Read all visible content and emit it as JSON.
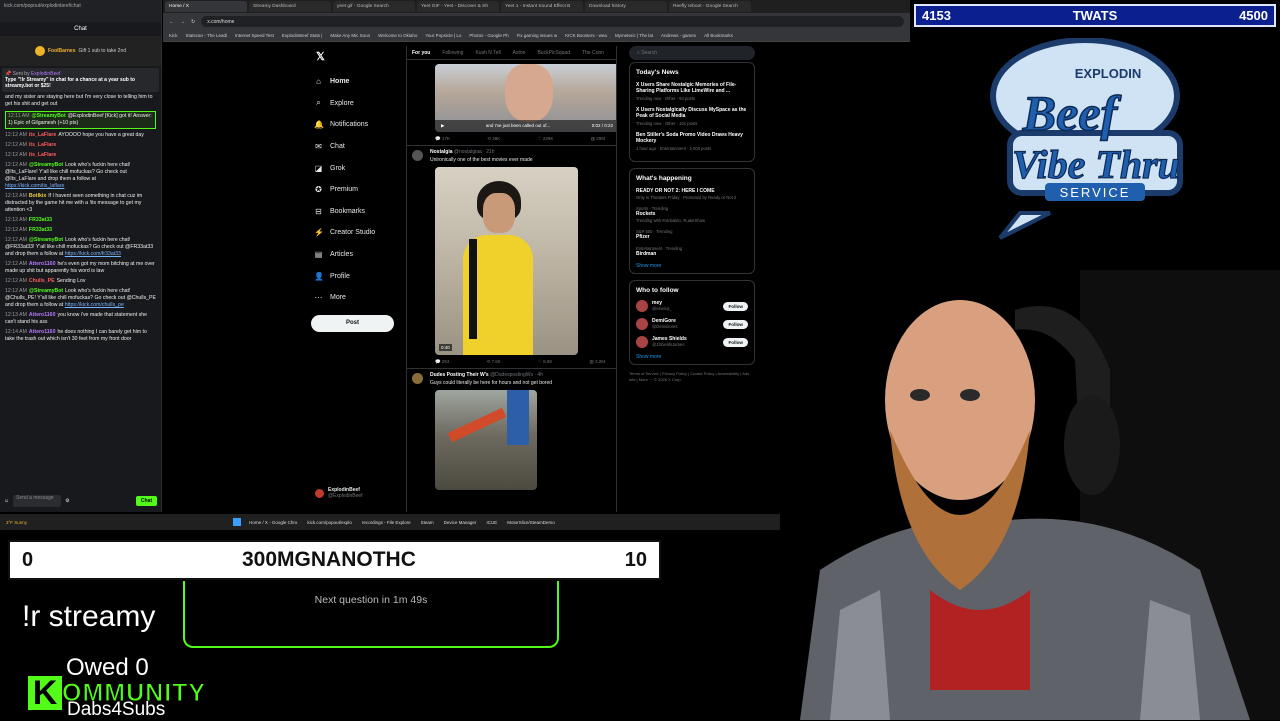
{
  "chat": {
    "url": "kick.com/popout/explodinbeef/chat",
    "title": "Chat",
    "gift_user": "FoolBarnes",
    "gift_text": "Gift 1 sub to take 2nd",
    "pinned_by": "ExplodinBeef",
    "pinned_text": "Type \"!lr Streamy\" in chat for a chance at a year sub to streamy.bot or $25!",
    "messages": [
      {
        "time": "",
        "user": "",
        "color": "",
        "text": "and my sister are staying here but I'm very close to telling him to get his shit and get out",
        "link": ""
      },
      {
        "time": "12:11 AM",
        "user": "@StreamyBot",
        "color": "g",
        "text": "@ExplodinBeef [Kick] got it! Answer: 1) Epic of Gilgamesh (+10 pts)",
        "link": "",
        "hl": true
      },
      {
        "time": "12:12 AM",
        "user": "its_LaFlare",
        "color": "r",
        "text": "AYOOOO hope you have a great day",
        "link": ""
      },
      {
        "time": "12:12 AM",
        "user": "its_LaFlare",
        "color": "r",
        "text": "",
        "link": ""
      },
      {
        "time": "12:12 AM",
        "user": "its_LaFlare",
        "color": "r",
        "text": "",
        "link": ""
      },
      {
        "time": "12:12 AM",
        "user": "@StreamyBot",
        "color": "g",
        "text": "Look who's fuckin here chat! @Its_LaFlare! Y'all like chill mofuckas? Go check out @Its_LaFlare and drop them a follow at",
        "link": "https://kick.com/its_laflare"
      },
      {
        "time": "12:12 AM",
        "user": "Botlkix",
        "color": "y",
        "text": "If I havent seen something in chat cuz im distracted by the game hit me with a !its message to get my attention <3",
        "link": ""
      },
      {
        "time": "12:12 AM",
        "user": "FR33at33",
        "color": "g",
        "text": "",
        "link": ""
      },
      {
        "time": "12:12 AM",
        "user": "FR33at33",
        "color": "g",
        "text": "",
        "link": ""
      },
      {
        "time": "12:12 AM",
        "user": "@StreamyBot",
        "color": "g",
        "text": "Look who's fuckin here chat! @FR33at33! Y'all like chill mofuckas? Go check out @FR33at33 and drop them a follow at",
        "link": "https://kick.com/fr33at33"
      },
      {
        "time": "12:12 AM",
        "user": "Attero1160",
        "color": "p",
        "text": "he's even got my mom bitching at me over made up shit but apparently his word is law",
        "link": ""
      },
      {
        "time": "12:12 AM",
        "user": "Chulls_PE",
        "color": "r",
        "text": "Sending Lov",
        "link": ""
      },
      {
        "time": "12:12 AM",
        "user": "@StreamyBot",
        "color": "g",
        "text": "Look who's fuckin here chat! @Chulls_PE! Y'all like chill mofuckas? Go check out @Chulls_PE and drop them a follow at",
        "link": "https://kick.com/chulls_pe"
      },
      {
        "time": "12:13 AM",
        "user": "Attero1160",
        "color": "p",
        "text": "you know i've made that statement she can't stand his ass",
        "link": ""
      },
      {
        "time": "12:14 AM",
        "user": "Attero1160",
        "color": "p",
        "text": "he does nothing I can barely get him to take the trash out which isn't 30 feet from my front door",
        "link": ""
      }
    ],
    "input_placeholder": "Send a message",
    "send_label": "Chat"
  },
  "browser": {
    "tabs": [
      "Home / X",
      "Streamy Dashboard",
      "yeet gif - Google Search",
      "Yeet GIF - Yeet - Discover & Sh",
      "Yeet 1 - Instant Sound Effect B",
      "Download history",
      "Reefly reboot - Google Search"
    ],
    "address": "x.com/home",
    "bookmarks": [
      "Kick",
      "Statscan - The Leadi",
      "Internet Speed Test",
      "ExplodinBeef Stats |",
      "Make Any Mic Soun",
      "Welcome to Oklaho",
      "Your Popsicle | Lo",
      "Photos - Google Ph",
      "Fix gaming issues w",
      "KICK Boosters - wea",
      "Mymeteric | The lat",
      "Andrews - games",
      "All Bookmarks"
    ]
  },
  "xnav": {
    "logo": "𝕏",
    "items": [
      {
        "icon": "⌂",
        "label": "Home"
      },
      {
        "icon": "⌕",
        "label": "Explore"
      },
      {
        "icon": "🔔",
        "label": "Notifications"
      },
      {
        "icon": "✉",
        "label": "Chat"
      },
      {
        "icon": "◪",
        "label": "Grok"
      },
      {
        "icon": "✪",
        "label": "Premium"
      },
      {
        "icon": "⊟",
        "label": "Bookmarks"
      },
      {
        "icon": "⚡",
        "label": "Creator Studio"
      },
      {
        "icon": "▤",
        "label": "Articles"
      },
      {
        "icon": "👤",
        "label": "Profile"
      },
      {
        "icon": "⋯",
        "label": "More"
      }
    ],
    "post_label": "Post",
    "me_name": "ExplodinBeef",
    "me_handle": "@ExplodinBeef"
  },
  "feed": {
    "tabs": [
      "For you",
      "Following",
      "Kush N Tell",
      "Aston",
      "BuckPicSquad",
      "The Conn"
    ],
    "tweet1": {
      "video_caption": "and I've just been called out of...",
      "time": "0:02 / 0:22",
      "stats": [
        "17K",
        "28K",
        "228K",
        "20M"
      ]
    },
    "tweet2": {
      "name": "Nostalgia",
      "handle": "@nostalgiaa · 21h",
      "text": "Unironically one of the best movies ever made",
      "duration": "0:40",
      "stats": [
        "253",
        "7.6K",
        "8.5K",
        "2.2M"
      ]
    },
    "tweet3": {
      "name": "Dudes Posting Their W's",
      "handle": "@DudespostingWs · 4h",
      "text": "Guys could literally be here for hours and not get bored"
    }
  },
  "right": {
    "search": "Search",
    "today_title": "Today's News",
    "news": [
      {
        "title": "X Users Share Nostalgic Memories of File-Sharing Platforms Like LimeWire and ...",
        "meta": "Trending now · Other · 93 posts"
      },
      {
        "title": "X Users Nostalgically Discuss MySpace as the Peak of Social Media",
        "meta": "Trending now · Other · 101 posts"
      },
      {
        "title": "Ben Stiller's Soda Promo Video Draws Heavy Mockery",
        "meta": "1 hour ago · Entertainment · 2,003 posts"
      }
    ],
    "happening_title": "What's happening",
    "trends": [
      {
        "cat": "",
        "name": "READY OR NOT 2: HERE I COME",
        "sub": "Only in Theaters Friday · Promoted by Ready or Not 2"
      },
      {
        "cat": "Sports · Trending",
        "name": "Rockets",
        "sub": "Trending with #ronbaldo, #LakeShow"
      },
      {
        "cat": "S&P 500 · Trending",
        "name": "Pfizer",
        "sub": ""
      },
      {
        "cat": "Entertainment · Trending",
        "name": "Birdman",
        "sub": ""
      }
    ],
    "show_more": "Show more",
    "who_title": "Who to follow",
    "who": [
      {
        "name": "mey",
        "handle": "@elovica_"
      },
      {
        "name": "DemiGore",
        "handle": "@DemiGores"
      },
      {
        "name": "James Shields",
        "handle": "@JShieldsJames"
      }
    ],
    "follow_label": "Follow",
    "footer": "Terms of Service | Privacy Policy | Cookie Policy | Accessibility | Ads info | More ··· © 2026 X Corp."
  },
  "taskbar": {
    "weather": "3°F Sunny",
    "apps": [
      "Home / X - Google Chro",
      "kick.com/popout/explo",
      "recordings - File Explore",
      "Steam",
      "Device Manager",
      "ICUE",
      "MotorSlice/SteamDemo"
    ]
  },
  "overlay": {
    "left_score": "4153",
    "team_name": "TWATS",
    "right_score": "4500",
    "brand_line1": "EXPLODIN",
    "brand_line2": "Beef",
    "brand_line3": "Vibe Thru",
    "brand_line4": "SERVICE",
    "trivia_left": "0",
    "trivia_question": "300MGNANOTHC",
    "trivia_right": "10",
    "next_question": "Next question in 1m 49s",
    "command": "!r streamy",
    "owed": "Owed 0",
    "kick_k": "K",
    "kick_word": "OMMUNITY",
    "dabs": "Dabs4Subs"
  }
}
